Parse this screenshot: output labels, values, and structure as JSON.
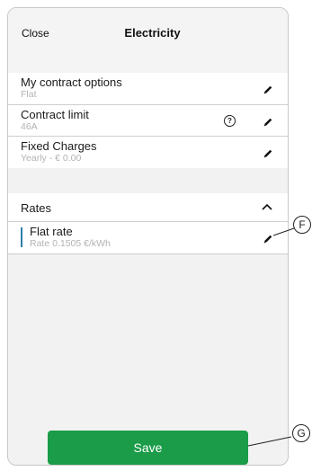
{
  "header": {
    "close_label": "Close",
    "title": "Electricity"
  },
  "options": [
    {
      "label": "My contract options",
      "value": "Flat",
      "icon": "pencil-icon"
    },
    {
      "label": "Contract limit",
      "value": "46A",
      "help_icon": "question-icon",
      "icon": "pencil-icon"
    },
    {
      "label": "Fixed Charges",
      "value": "Yearly - € 0.00",
      "icon": "pencil-icon"
    }
  ],
  "rates": {
    "header_label": "Rates",
    "toggle_icon": "chevron-up-icon",
    "items": [
      {
        "label": "Flat rate",
        "value": "Rate 0.1505 €/kWh",
        "icon": "pencil-icon"
      }
    ]
  },
  "help_glyph": "?",
  "save_label": "Save",
  "callouts": {
    "f": "F",
    "g": "G"
  },
  "colors": {
    "save_green": "#1a9c48",
    "accent_blue": "#2a7fa5"
  }
}
